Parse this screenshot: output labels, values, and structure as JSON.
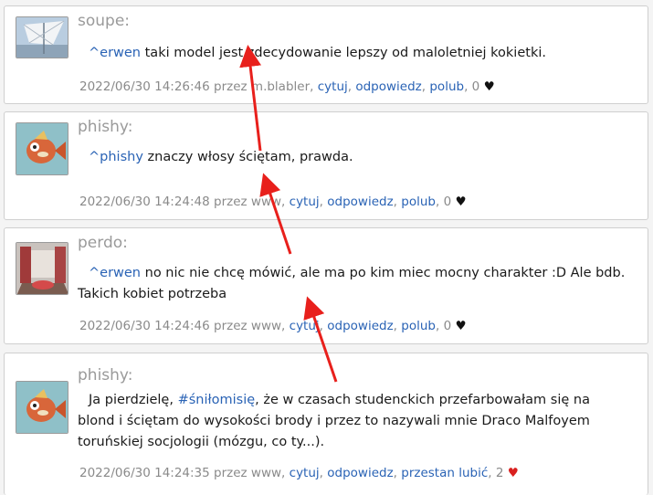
{
  "posts": [
    {
      "author": "soupe:",
      "mention": "^erwen",
      "text_before": "",
      "text_after": " taki model jest zdecydowanie lepszy od maloletniej kokietki.",
      "timestamp": "2022/06/30 14:26:46",
      "via": "przez m.blabler,",
      "cite": "cytuj",
      "reply": "odpowiedz",
      "like": "polub",
      "like_count": "0",
      "heart": "♥"
    },
    {
      "author": "phishy:",
      "mention": "^phishy",
      "text_before": "",
      "text_after": " znaczy włosy ściętam, prawda.",
      "timestamp": "2022/06/30 14:24:48",
      "via": "przez www,",
      "cite": "cytuj",
      "reply": "odpowiedz",
      "like": "polub",
      "like_count": "0",
      "heart": "♥"
    },
    {
      "author": "perdo:",
      "mention": "^erwen",
      "text_before": "",
      "text_after": " no nic nie chcę mówić, ale ma po kim miec mocny charakter :D Ale bdb. Takich kobiet potrzeba",
      "timestamp": "2022/06/30 14:24:46",
      "via": "przez www,",
      "cite": "cytuj",
      "reply": "odpowiedz",
      "like": "polub",
      "like_count": "0",
      "heart": "♥"
    },
    {
      "author": "phishy:",
      "mention": "#śniłomisię",
      "text_before": "Ja pierdzielę, ",
      "text_after": ", że w czasach studenckich przefarbowałam się na blond i ściętam do wysokości brody i przez to nazywali mnie Draco Malfoyem toruńskiej socjologii (mózgu, co ty...).",
      "timestamp": "2022/06/30 14:24:35",
      "via": "przez www,",
      "cite": "cytuj",
      "reply": "odpowiedz",
      "like": "przestan lubić",
      "like_count": "2",
      "heart": "♥"
    }
  ],
  "colors": {
    "link": "#2a63b5",
    "annotation_arrow": "#e8201c",
    "liked_heart": "#d9201f"
  }
}
